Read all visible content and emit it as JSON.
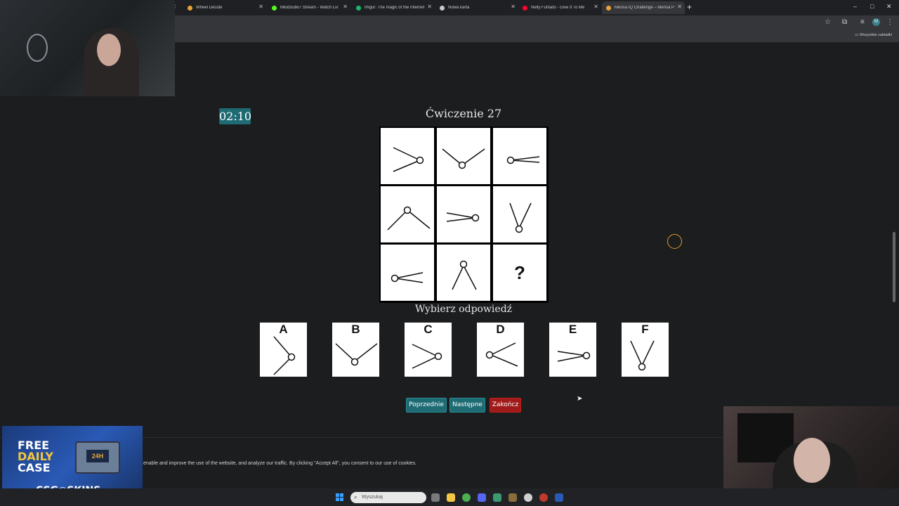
{
  "browser": {
    "tabs": [
      {
        "label": "",
        "favicon_color": "#777777"
      },
      {
        "label": "Wheel Decide",
        "favicon_color": "#e8a33a"
      },
      {
        "label": "Młodziutki7 Stream - Watch Liv",
        "favicon_color": "#53fc18"
      },
      {
        "label": "Imgur: The magic of the Internet",
        "favicon_color": "#1bb76e"
      },
      {
        "label": "Nowa karta",
        "favicon_color": "#c8c8c8"
      },
      {
        "label": "Nelly Furtado - Give It To Me",
        "favicon_color": "#ff0033"
      },
      {
        "label": "Mensa IQ Challenge – Mensa P",
        "favicon_color": "#e8a33a",
        "active": true
      }
    ],
    "new_tab": "+",
    "window_controls": {
      "minimize": "–",
      "maximize": "□",
      "close": "✕"
    },
    "bookmarks_all": "Wszystkie zakładki",
    "profile_initial": "M"
  },
  "quiz": {
    "timer": "02:10",
    "title": "Ćwiczenie 27",
    "question_mark": "?",
    "prompt": "Wybierz odpowiedź",
    "options": [
      "A",
      "B",
      "C",
      "D",
      "E",
      "F"
    ],
    "buttons": {
      "prev": "Poprzednie",
      "next": "Następne",
      "finish": "Zakończ"
    },
    "colors": {
      "teal": "#1e6b74",
      "red": "#a01a1a",
      "cursor_ring": "#e29a28"
    }
  },
  "cookie_banner": {
    "text": "enable and improve the use of the website, and analyze our traffic. By clicking \"Accept All\", you consent to our use of cookies."
  },
  "ad": {
    "line1": "FREE",
    "line2": "DAILY",
    "line3": "CASE",
    "badge": "24H",
    "brand": "CSG◉SKINS"
  },
  "taskbar": {
    "search_placeholder": "Wyszukaj"
  }
}
